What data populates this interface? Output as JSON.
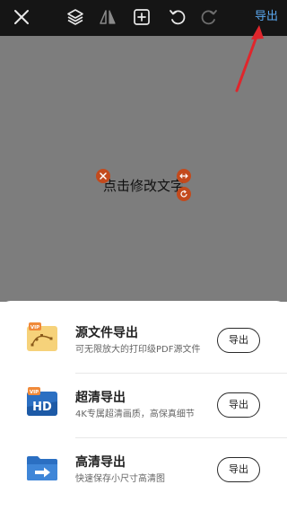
{
  "toolbar": {
    "export_label": "导出",
    "icons": [
      "close-icon",
      "layers-icon",
      "flip-icon",
      "add-element-icon",
      "undo-icon",
      "redo-icon"
    ]
  },
  "canvas": {
    "text": "点击修改文字"
  },
  "export_sheet": {
    "options": [
      {
        "title": "源文件导出",
        "desc": "可无限放大的打印级PDF源文件",
        "button": "导出",
        "badge": "VIP",
        "icon": "source-file-icon"
      },
      {
        "title": "超清导出",
        "desc": "4K专属超清画质，高保真细节",
        "button": "导出",
        "badge": "VIP",
        "icon": "hd-icon",
        "icon_text": "HD"
      },
      {
        "title": "高清导出",
        "desc": "快速保存小尺寸高清图",
        "button": "导出",
        "icon": "folder-export-icon"
      }
    ]
  },
  "colors": {
    "toolbar_bg": "#151515",
    "export_link": "#5aa8f0",
    "canvas_bg": "#7d7d7d",
    "handle": "#c34a1d",
    "annotation_arrow": "#e0262c",
    "vip_badge": "#f08a3a",
    "hd_blue": "#2b6fc2"
  }
}
